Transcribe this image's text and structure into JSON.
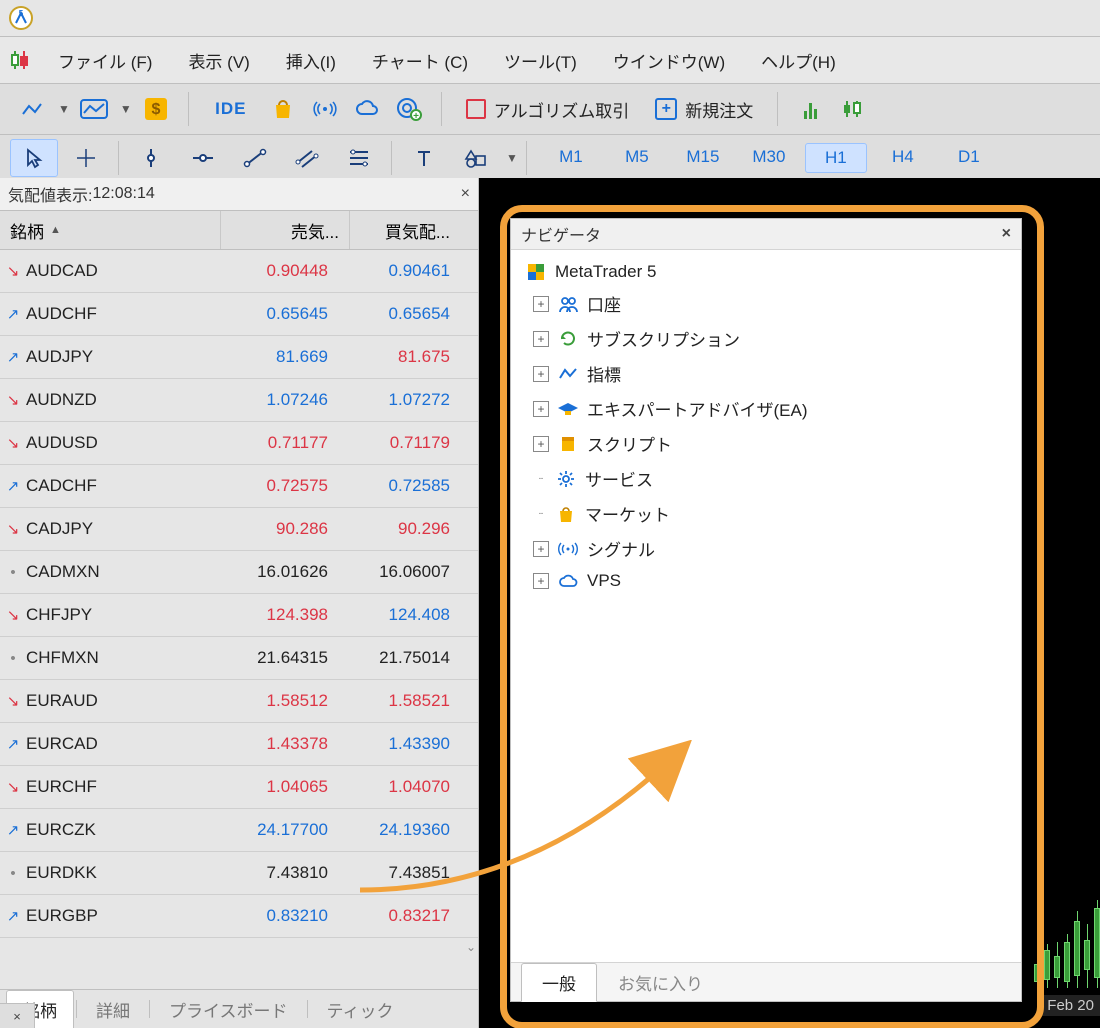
{
  "menu": [
    "ファイル (F)",
    "表示 (V)",
    "挿入(I)",
    "チャート (C)",
    "ツール(T)",
    "ウインドウ(W)",
    "ヘルプ(H)"
  ],
  "toolbar1": {
    "ide": "IDE",
    "algo": "アルゴリズム取引",
    "neworder": "新規注文"
  },
  "timeframes": [
    "M1",
    "M5",
    "M15",
    "M30",
    "H1",
    "H4",
    "D1"
  ],
  "tf_active": "H1",
  "market_watch": {
    "title_prefix": "気配値表示: ",
    "time": "12:08:14",
    "col_symbol": "銘柄",
    "col_bid": "売気...",
    "col_ask": "買気配...",
    "tabs": [
      "銘柄",
      "詳細",
      "プライスボード",
      "ティック"
    ],
    "rows": [
      {
        "dir": "down",
        "sym": "AUDCAD",
        "bid": "0.90448",
        "bcls": "tx-red",
        "ask": "0.90461",
        "acls": "tx-blue"
      },
      {
        "dir": "up",
        "sym": "AUDCHF",
        "bid": "0.65645",
        "bcls": "tx-blue",
        "ask": "0.65654",
        "acls": "tx-blue"
      },
      {
        "dir": "up",
        "sym": "AUDJPY",
        "bid": "81.669",
        "bcls": "tx-blue",
        "ask": "81.675",
        "acls": "tx-red"
      },
      {
        "dir": "down",
        "sym": "AUDNZD",
        "bid": "1.07246",
        "bcls": "tx-blue",
        "ask": "1.07272",
        "acls": "tx-blue"
      },
      {
        "dir": "down",
        "sym": "AUDUSD",
        "bid": "0.71177",
        "bcls": "tx-red",
        "ask": "0.71179",
        "acls": "tx-red"
      },
      {
        "dir": "up",
        "sym": "CADCHF",
        "bid": "0.72575",
        "bcls": "tx-red",
        "ask": "0.72585",
        "acls": "tx-blue"
      },
      {
        "dir": "down",
        "sym": "CADJPY",
        "bid": "90.286",
        "bcls": "tx-red",
        "ask": "90.296",
        "acls": "tx-red"
      },
      {
        "dir": "flat",
        "sym": "CADMXN",
        "bid": "16.01626",
        "bcls": "tx-black",
        "ask": "16.06007",
        "acls": "tx-black"
      },
      {
        "dir": "down",
        "sym": "CHFJPY",
        "bid": "124.398",
        "bcls": "tx-red",
        "ask": "124.408",
        "acls": "tx-blue"
      },
      {
        "dir": "flat",
        "sym": "CHFMXN",
        "bid": "21.64315",
        "bcls": "tx-black",
        "ask": "21.75014",
        "acls": "tx-black"
      },
      {
        "dir": "down",
        "sym": "EURAUD",
        "bid": "1.58512",
        "bcls": "tx-red",
        "ask": "1.58521",
        "acls": "tx-red"
      },
      {
        "dir": "up",
        "sym": "EURCAD",
        "bid": "1.43378",
        "bcls": "tx-red",
        "ask": "1.43390",
        "acls": "tx-blue"
      },
      {
        "dir": "down",
        "sym": "EURCHF",
        "bid": "1.04065",
        "bcls": "tx-red",
        "ask": "1.04070",
        "acls": "tx-red"
      },
      {
        "dir": "up",
        "sym": "EURCZK",
        "bid": "24.17700",
        "bcls": "tx-blue",
        "ask": "24.19360",
        "acls": "tx-blue"
      },
      {
        "dir": "flat",
        "sym": "EURDKK",
        "bid": "7.43810",
        "bcls": "tx-black",
        "ask": "7.43851",
        "acls": "tx-black"
      },
      {
        "dir": "up",
        "sym": "EURGBP",
        "bid": "0.83210",
        "bcls": "tx-blue",
        "ask": "0.83217",
        "acls": "tx-red"
      }
    ]
  },
  "navigator": {
    "title": "ナビゲータ",
    "root": "MetaTrader 5",
    "items": [
      {
        "label": "口座",
        "icon": "users",
        "exp": true
      },
      {
        "label": "サブスクリプション",
        "icon": "refresh",
        "exp": true
      },
      {
        "label": "指標",
        "icon": "indicator",
        "exp": true
      },
      {
        "label": "エキスパートアドバイザ(EA)",
        "icon": "grad",
        "exp": true
      },
      {
        "label": "スクリプト",
        "icon": "script",
        "exp": true
      },
      {
        "label": "サービス",
        "icon": "gear",
        "exp": false
      },
      {
        "label": "マーケット",
        "icon": "bag",
        "exp": false
      },
      {
        "label": "シグナル",
        "icon": "signal",
        "exp": true
      },
      {
        "label": "VPS",
        "icon": "cloud",
        "exp": true
      }
    ],
    "tabs": [
      "一般",
      "お気に入り"
    ]
  },
  "chart": {
    "date_label": "Feb 20"
  }
}
